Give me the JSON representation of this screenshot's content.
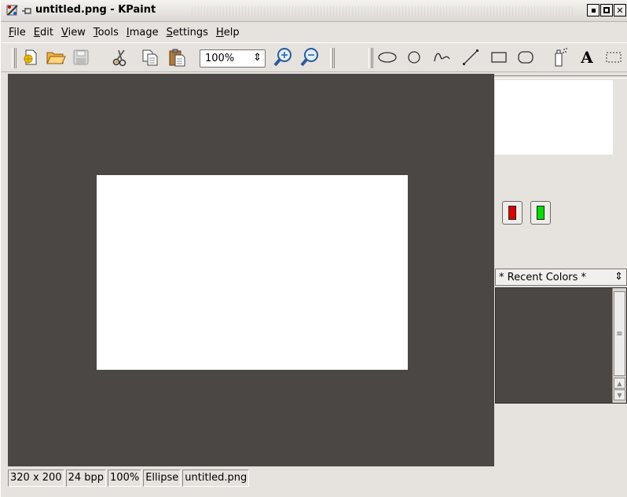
{
  "window": {
    "title": "untitled.png - KPaint",
    "controls": [
      "minimize-button",
      "maximize-button",
      "close-button"
    ]
  },
  "menubar": {
    "items": [
      "File",
      "Edit",
      "View",
      "Tools",
      "Image",
      "Settings",
      "Help"
    ]
  },
  "toolbar": {
    "zoom_value": "100%",
    "text_tool_label": "A"
  },
  "right_panel": {
    "recent_colors_label": "* Recent Colors *",
    "foreground_color": "#e00000",
    "background_color": "#00e000"
  },
  "statusbar": {
    "dimensions": "320 x 200",
    "depth": "24 bpp",
    "zoom": "100%",
    "tool": "Ellipse",
    "filename": "untitled.png"
  }
}
